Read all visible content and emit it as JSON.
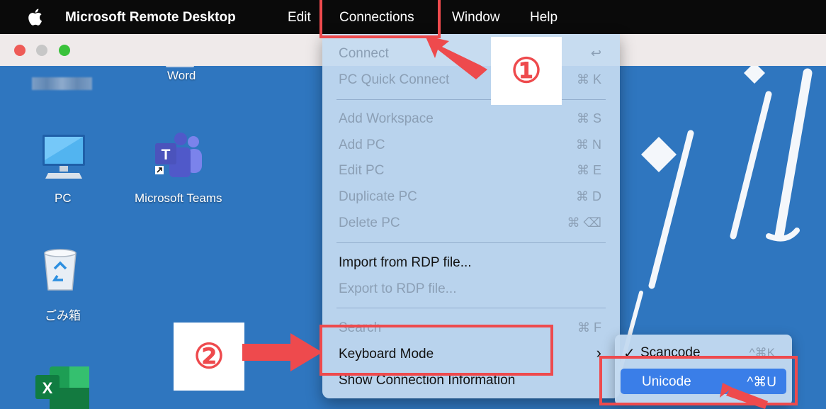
{
  "menubar": {
    "app_name": "Microsoft Remote Desktop",
    "items": [
      "Edit",
      "Connections",
      "Window",
      "Help"
    ]
  },
  "desktop": {
    "icons": [
      {
        "label": "Word"
      },
      {
        "label": "PC"
      },
      {
        "label": "Microsoft Teams"
      },
      {
        "label": "ごみ箱"
      }
    ]
  },
  "connections_menu": {
    "items": [
      {
        "label": "Connect",
        "shortcut": "↩",
        "enabled": false
      },
      {
        "label": "PC Quick Connect",
        "shortcut": "⌘ K",
        "enabled": false
      },
      {
        "label": "Add Workspace",
        "shortcut": "⌘ S",
        "enabled": false
      },
      {
        "label": "Add PC",
        "shortcut": "⌘ N",
        "enabled": false
      },
      {
        "label": "Edit PC",
        "shortcut": "⌘ E",
        "enabled": false
      },
      {
        "label": "Duplicate PC",
        "shortcut": "⌘ D",
        "enabled": false
      },
      {
        "label": "Delete PC",
        "shortcut": "⌘ ⌫",
        "enabled": false
      },
      {
        "label": "Import from RDP file...",
        "shortcut": "",
        "enabled": true
      },
      {
        "label": "Export to RDP file...",
        "shortcut": "",
        "enabled": false
      },
      {
        "label": "Search",
        "shortcut": "⌘ F",
        "enabled": false
      },
      {
        "label": "Keyboard Mode",
        "shortcut": "›",
        "enabled": true
      },
      {
        "label": "Show Connection Information",
        "shortcut": "",
        "enabled": true
      }
    ]
  },
  "keyboard_submenu": {
    "items": [
      {
        "label": "Scancode",
        "shortcut": "^⌘K",
        "checked": true,
        "check": "✓"
      },
      {
        "label": "Unicode",
        "shortcut": "^⌘U",
        "checked": false,
        "selected": true
      }
    ]
  },
  "annotations": {
    "step1": "①",
    "step2": "②"
  },
  "colors": {
    "desktop_bg": "#2f76bf",
    "menubar_bg": "#0a0a0a",
    "highlight_red": "#ee4a4d",
    "selection_blue": "#3a7ee8"
  }
}
